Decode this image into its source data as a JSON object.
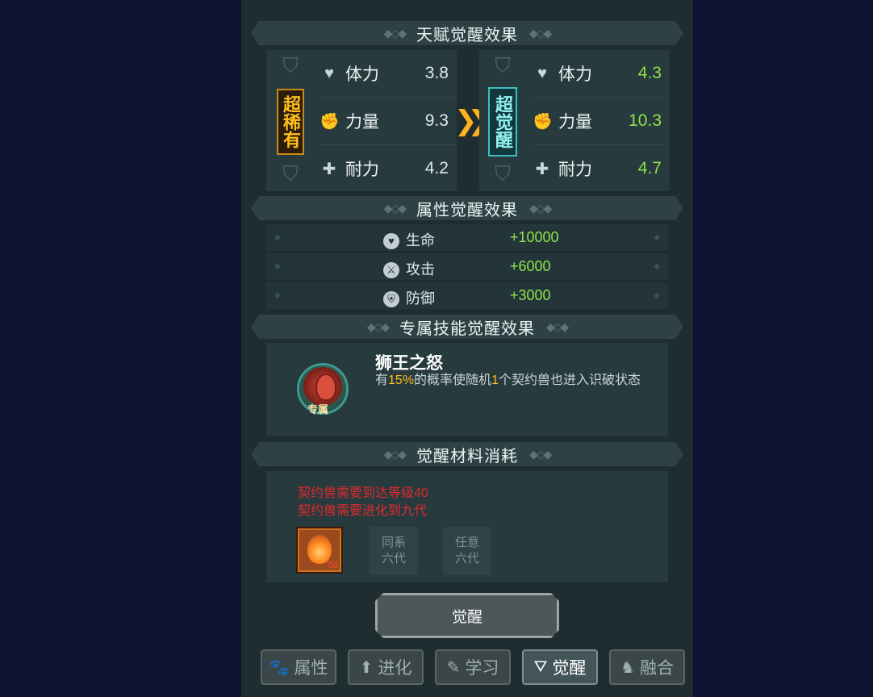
{
  "sections": {
    "talent": "天赋觉醒效果",
    "attribute": "属性觉醒效果",
    "skill": "专属技能觉醒效果",
    "material": "觉醒材料消耗"
  },
  "talent": {
    "before_tag": "超稀有",
    "after_tag": "超觉醒",
    "before": [
      {
        "label": "体力",
        "value": "3.8"
      },
      {
        "label": "力量",
        "value": "9.3"
      },
      {
        "label": "耐力",
        "value": "4.2"
      }
    ],
    "after": [
      {
        "label": "体力",
        "value": "4.3"
      },
      {
        "label": "力量",
        "value": "10.3"
      },
      {
        "label": "耐力",
        "value": "4.7"
      }
    ]
  },
  "attributes": [
    {
      "label": "生命",
      "value": "+10000"
    },
    {
      "label": "攻击",
      "value": "+6000"
    },
    {
      "label": "防御",
      "value": "+3000"
    }
  ],
  "skill": {
    "name": "狮王之怒",
    "badge": "专属",
    "desc_1": "有",
    "desc_pct": "15%",
    "desc_2": "的概率使随机",
    "desc_num": "1",
    "desc_3": "个契约兽也进入识破状态"
  },
  "materials": {
    "req_1": "契约兽需要到达等级40",
    "req_2": "契约兽需要进化到九代",
    "item_count": "50",
    "slot_2": [
      "同系",
      "六代"
    ],
    "slot_3": [
      "任意",
      "六代"
    ]
  },
  "awaken_button": "觉醒",
  "tabs": [
    {
      "label": "属性",
      "icon": "paw-icon"
    },
    {
      "label": "进化",
      "icon": "arrow-up-icon"
    },
    {
      "label": "学习",
      "icon": "book-icon"
    },
    {
      "label": "觉醒",
      "icon": "beast-face-icon"
    },
    {
      "label": "融合",
      "icon": "merge-icon"
    }
  ],
  "colors": {
    "green": "#8ee34a",
    "gold": "#ffbe1c",
    "red": "#e02a2a",
    "teal": "#3dbec0"
  }
}
